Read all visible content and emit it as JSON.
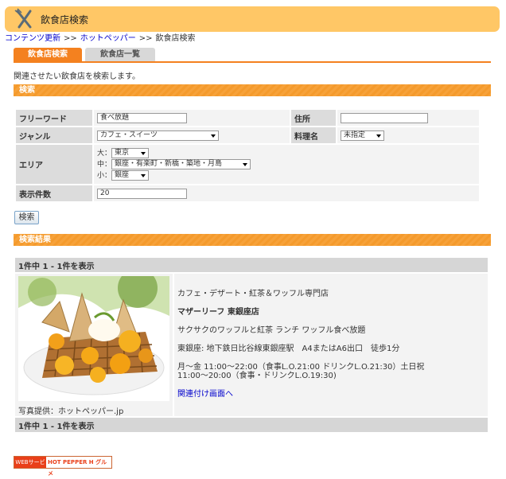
{
  "header": {
    "title": "飲食店検索",
    "icon": "fork-knife-icon"
  },
  "breadcrumb": {
    "items": [
      "コンテンツ更新",
      "ホットペッパー",
      "飲食店検索"
    ],
    "separator": ">>"
  },
  "tabs": [
    {
      "label": "飲食店検索",
      "active": true
    },
    {
      "label": "飲食店一覧",
      "active": false
    }
  ],
  "intro": "関連させたい飲食店を検索します。",
  "search_section": {
    "title": "検索",
    "freeword": {
      "label": "フリーワード",
      "value": "食べ放題"
    },
    "address": {
      "label": "住所",
      "value": ""
    },
    "genre": {
      "label": "ジャンル",
      "value": "カフェ・スイーツ"
    },
    "cuisine": {
      "label": "料理名",
      "value": "未指定"
    },
    "area": {
      "label": "エリア",
      "large_label": "大：",
      "large": "東京",
      "middle_label": "中：",
      "middle": "銀座・有楽町・新橋・築地・月島",
      "small_label": "小：",
      "small": "銀座"
    },
    "count": {
      "label": "表示件数",
      "value": "20"
    },
    "button": "検索"
  },
  "results_section": {
    "title": "検索結果",
    "summary_top": "1件中 1 - 1件を表示",
    "summary_bottom": "1件中 1 - 1件を表示",
    "item": {
      "category": "カフェ・デザート・紅茶＆ワッフル専門店",
      "name": "マザーリーフ 東銀座店",
      "catch": "サクサクのワッフルと紅茶 ランチ ワッフル食べ放題",
      "access": "東銀座: 地下鉄日比谷線東銀座駅　A4またはA6出口　徒歩1分",
      "hours_line1": "月～金 11:00～22:00（食事L.O.21:00 ドリンクL.O.21:30）土日祝",
      "hours_line2": "11:00～20:00（食事・ドリンクL.O.19:30)",
      "link": "関連付け画面へ",
      "photo_credit": "写真提供：ホットペッパー.jp"
    }
  },
  "footer_badge": {
    "left": "WEBサービス",
    "right": "HOT PEPPER H グルメ"
  },
  "colors": {
    "accent": "#f4811f",
    "title_bar": "#ffc766",
    "link": "#0000cc"
  }
}
